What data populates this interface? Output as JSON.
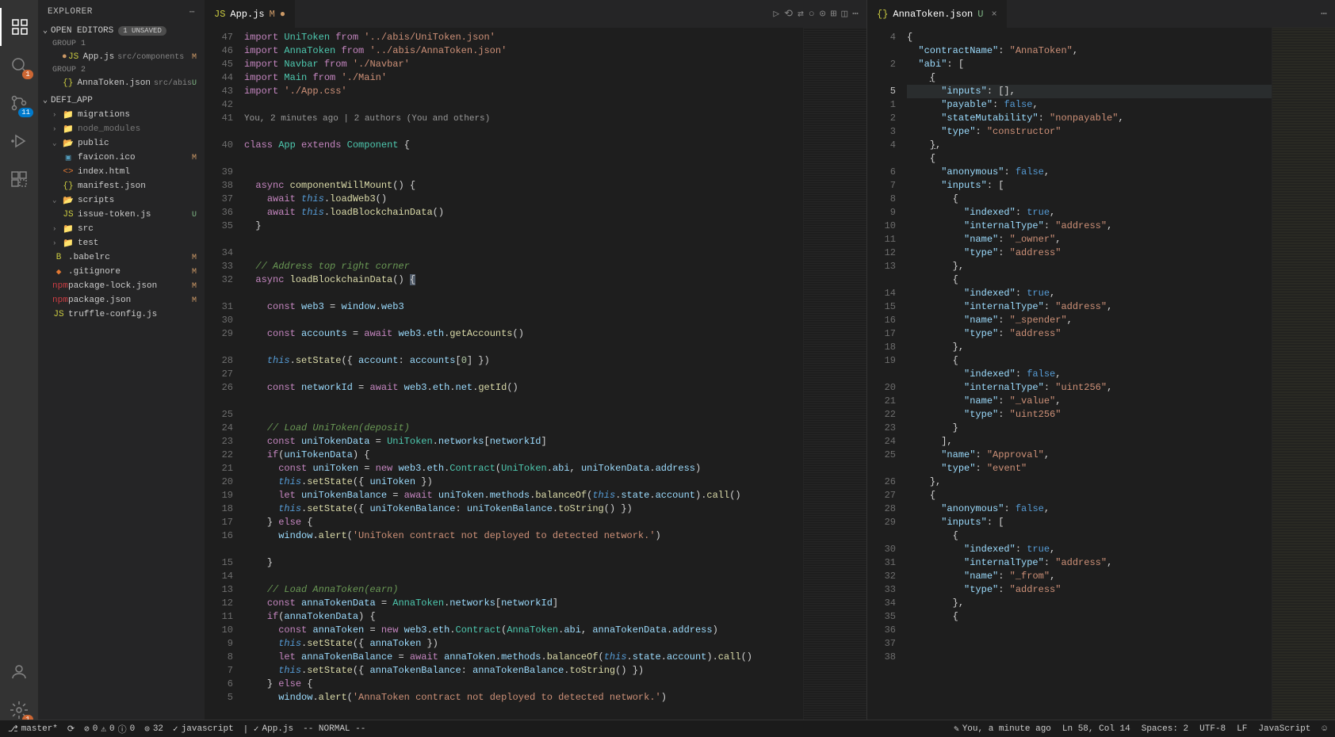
{
  "sidebar": {
    "title": "EXPLORER",
    "openEditors": "OPEN EDITORS",
    "unsavedBadge": "1 UNSAVED",
    "group1": "GROUP 1",
    "group2": "GROUP 2",
    "editor1": {
      "name": "App.js",
      "path": "src/components",
      "status": "M"
    },
    "editor2": {
      "name": "AnnaToken.json",
      "path": "src/abis",
      "status": "U"
    },
    "project": "DEFI_APP",
    "tree": {
      "migrations": "migrations",
      "node_modules": "node_modules",
      "public": "public",
      "favicon": "favicon.ico",
      "faviconStatus": "M",
      "index": "index.html",
      "manifest": "manifest.json",
      "scripts": "scripts",
      "issueToken": "issue-token.js",
      "issueTokenStatus": "U",
      "src": "src",
      "test": "test",
      "babelrc": ".babelrc",
      "babelrcStatus": "M",
      "gitignore": ".gitignore",
      "gitignoreStatus": "M",
      "packageLock": "package-lock.json",
      "packageLockStatus": "M",
      "package": "package.json",
      "packageStatus": "M",
      "truffle": "truffle-config.js"
    }
  },
  "tabs": {
    "left": {
      "name": "App.js",
      "status": "M",
      "dirty": "●"
    },
    "right": {
      "name": "AnnaToken.json",
      "status": "U"
    }
  },
  "leftGutter": [
    "47",
    "46",
    "45",
    "44",
    "43",
    "42",
    "41",
    "",
    "40",
    "",
    "39",
    "38",
    "37",
    "36",
    "35",
    "",
    "34",
    "33",
    "32",
    "",
    "31",
    "30",
    "29",
    "",
    "28",
    "27",
    "26",
    "",
    "25",
    "24",
    "23",
    "22",
    "21",
    "20",
    "19",
    "18",
    "17",
    "16",
    "",
    "15",
    "14",
    "13",
    "12",
    "11",
    "10",
    "9",
    "8",
    "7",
    "6",
    "5"
  ],
  "codeLens": "You, 2 minutes ago | 2 authors (You and others)",
  "rightGutter": [
    "4",
    "",
    "2",
    "",
    "5",
    "1",
    "2",
    "3",
    "4",
    "",
    "6",
    "7",
    "8",
    "9",
    "10",
    "11",
    "12",
    "13",
    "",
    "14",
    "15",
    "16",
    "17",
    "18",
    "19",
    "",
    "20",
    "21",
    "22",
    "23",
    "24",
    "25",
    "",
    "26",
    "27",
    "28",
    "29",
    "",
    "30",
    "31",
    "32",
    "33",
    "34",
    "35",
    "36",
    "37",
    "38",
    ""
  ],
  "statusBar": {
    "branch": "master*",
    "sync": "⟳",
    "errors": "0",
    "warnings": "0",
    "info": "0",
    "lines": "32",
    "lang1": "javascript",
    "file": "App.js",
    "mode": "-- NORMAL --",
    "blame": "You, a minute ago",
    "position": "Ln 58, Col 14",
    "spaces": "Spaces: 2",
    "encoding": "UTF-8",
    "eol": "LF",
    "lang2": "JavaScript"
  },
  "activityBadges": {
    "scm": "11",
    "bottom": "1"
  }
}
